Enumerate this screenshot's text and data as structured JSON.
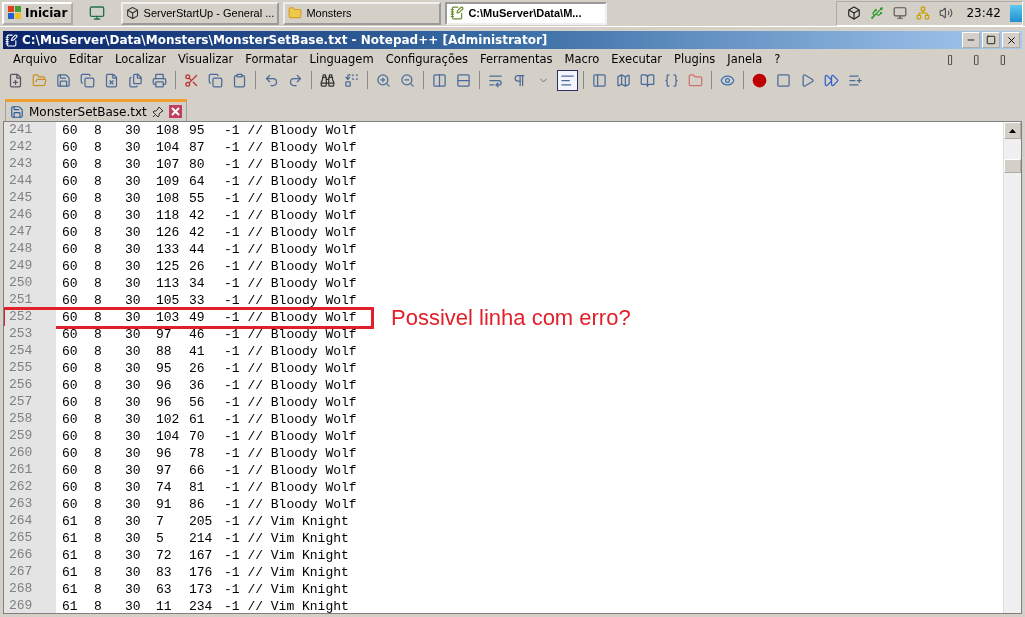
{
  "taskbar": {
    "start": "Iniciar",
    "tasks": [
      {
        "label": "ServerStartUp - General ...",
        "kind": "server",
        "selected": false
      },
      {
        "label": "Monsters",
        "kind": "folder",
        "selected": false
      },
      {
        "label": "C:\\MuServer\\Data\\M...",
        "kind": "notepad",
        "selected": true
      }
    ],
    "clock": "23:42"
  },
  "window": {
    "title": "C:\\MuServer\\Data\\Monsters\\MonsterSetBase.txt - Notepad++ [Administrator]"
  },
  "menu": [
    "Arquivo",
    "Editar",
    "Localizar",
    "Visualizar",
    "Formatar",
    "Linguagem",
    "Configurações",
    "Ferramentas",
    "Macro",
    "Executar",
    "Plugins",
    "Janela",
    "?"
  ],
  "menu_extra": [
    "▯",
    "▯",
    "▯"
  ],
  "toolbar": [
    [
      {
        "kind": "new",
        "selected": false
      },
      {
        "kind": "open",
        "selected": false
      },
      {
        "kind": "save",
        "selected": false
      },
      {
        "kind": "saveall",
        "selected": false
      },
      {
        "kind": "close",
        "selected": false
      },
      {
        "kind": "closeall",
        "selected": false
      },
      {
        "kind": "print",
        "selected": false
      }
    ],
    [
      {
        "kind": "cut",
        "selected": false
      },
      {
        "kind": "copy",
        "selected": false
      },
      {
        "kind": "paste",
        "selected": false
      }
    ],
    [
      {
        "kind": "undo",
        "selected": false
      },
      {
        "kind": "redo",
        "selected": false
      }
    ],
    [
      {
        "kind": "find",
        "selected": false
      },
      {
        "kind": "replace",
        "selected": false
      }
    ],
    [
      {
        "kind": "zoomin",
        "selected": false
      },
      {
        "kind": "zoomout",
        "selected": false
      }
    ],
    [
      {
        "kind": "syncv",
        "selected": false
      },
      {
        "kind": "synch",
        "selected": false
      }
    ],
    [
      {
        "kind": "wrap",
        "selected": false
      },
      {
        "kind": "pilcrow",
        "selected": false
      },
      {
        "kind": "dropdown",
        "selected": false
      },
      {
        "kind": "indent",
        "selected": true
      }
    ],
    [
      {
        "kind": "panel",
        "selected": false
      },
      {
        "kind": "map",
        "selected": false
      },
      {
        "kind": "docs",
        "selected": false
      },
      {
        "kind": "func",
        "selected": false
      },
      {
        "kind": "folder",
        "selected": false
      }
    ],
    [
      {
        "kind": "eye",
        "selected": false
      }
    ],
    [
      {
        "kind": "record",
        "selected": false
      },
      {
        "kind": "stop",
        "selected": false
      },
      {
        "kind": "play",
        "selected": false
      },
      {
        "kind": "playmulti",
        "selected": false
      },
      {
        "kind": "savemacro",
        "selected": false
      }
    ]
  ],
  "tabs": [
    {
      "label": "MonsterSetBase.txt",
      "selected": true
    }
  ],
  "lines": [
    {
      "number": "241",
      "cells": [
        "60",
        "8",
        "30",
        "108",
        "95",
        "-1 // Bloody Wolf"
      ],
      "marked": false
    },
    {
      "number": "242",
      "cells": [
        "60",
        "8",
        "30",
        "104",
        "87",
        "-1 // Bloody Wolf"
      ],
      "marked": false
    },
    {
      "number": "243",
      "cells": [
        "60",
        "8",
        "30",
        "107",
        "80",
        "-1 // Bloody Wolf"
      ],
      "marked": false
    },
    {
      "number": "244",
      "cells": [
        "60",
        "8",
        "30",
        "109",
        "64",
        "-1 // Bloody Wolf"
      ],
      "marked": false
    },
    {
      "number": "245",
      "cells": [
        "60",
        "8",
        "30",
        "108",
        "55",
        "-1 // Bloody Wolf"
      ],
      "marked": false
    },
    {
      "number": "246",
      "cells": [
        "60",
        "8",
        "30",
        "118",
        "42",
        "-1 // Bloody Wolf"
      ],
      "marked": false
    },
    {
      "number": "247",
      "cells": [
        "60",
        "8",
        "30",
        "126",
        "42",
        "-1 // Bloody Wolf"
      ],
      "marked": false
    },
    {
      "number": "248",
      "cells": [
        "60",
        "8",
        "30",
        "133",
        "44",
        "-1 // Bloody Wolf"
      ],
      "marked": false
    },
    {
      "number": "249",
      "cells": [
        "60",
        "8",
        "30",
        "125",
        "26",
        "-1 // Bloody Wolf"
      ],
      "marked": false
    },
    {
      "number": "250",
      "cells": [
        "60",
        "8",
        "30",
        "113",
        "34",
        "-1 // Bloody Wolf"
      ],
      "marked": false
    },
    {
      "number": "251",
      "cells": [
        "60",
        "8",
        "30",
        "105",
        "33",
        "-1 // Bloody Wolf"
      ],
      "marked": false
    },
    {
      "number": "252",
      "cells": [
        "60",
        "8",
        "30",
        "103",
        "49",
        "-1 // Bloody Wolf"
      ],
      "marked": true
    },
    {
      "number": "253",
      "cells": [
        "60",
        "8",
        "30",
        "97",
        "46",
        "-1 // Bloody Wolf"
      ],
      "marked": false
    },
    {
      "number": "254",
      "cells": [
        "60",
        "8",
        "30",
        "88",
        "41",
        "-1 // Bloody Wolf"
      ],
      "marked": false
    },
    {
      "number": "255",
      "cells": [
        "60",
        "8",
        "30",
        "95",
        "26",
        "-1 // Bloody Wolf"
      ],
      "marked": false
    },
    {
      "number": "256",
      "cells": [
        "60",
        "8",
        "30",
        "96",
        "36",
        "-1 // Bloody Wolf"
      ],
      "marked": false
    },
    {
      "number": "257",
      "cells": [
        "60",
        "8",
        "30",
        "96",
        "56",
        "-1 // Bloody Wolf"
      ],
      "marked": false
    },
    {
      "number": "258",
      "cells": [
        "60",
        "8",
        "30",
        "102",
        "61",
        "-1 // Bloody Wolf"
      ],
      "marked": false
    },
    {
      "number": "259",
      "cells": [
        "60",
        "8",
        "30",
        "104",
        "70",
        "-1 // Bloody Wolf"
      ],
      "marked": false
    },
    {
      "number": "260",
      "cells": [
        "60",
        "8",
        "30",
        "96",
        "78",
        "-1 // Bloody Wolf"
      ],
      "marked": false
    },
    {
      "number": "261",
      "cells": [
        "60",
        "8",
        "30",
        "97",
        "66",
        "-1 // Bloody Wolf"
      ],
      "marked": false
    },
    {
      "number": "262",
      "cells": [
        "60",
        "8",
        "30",
        "74",
        "81",
        "-1 // Bloody Wolf"
      ],
      "marked": false
    },
    {
      "number": "263",
      "cells": [
        "60",
        "8",
        "30",
        "91",
        "86",
        "-1 // Bloody Wolf"
      ],
      "marked": false
    },
    {
      "number": "264",
      "cells": [
        "61",
        "8",
        "30",
        "7",
        "205",
        "-1 // Vim Knight"
      ],
      "marked": false
    },
    {
      "number": "265",
      "cells": [
        "61",
        "8",
        "30",
        "5",
        "214",
        "-1 // Vim Knight"
      ],
      "marked": false
    },
    {
      "number": "266",
      "cells": [
        "61",
        "8",
        "30",
        "72",
        "167",
        "-1 // Vim Knight"
      ],
      "marked": false
    },
    {
      "number": "267",
      "cells": [
        "61",
        "8",
        "30",
        "83",
        "176",
        "-1 // Vim Knight"
      ],
      "marked": false
    },
    {
      "number": "268",
      "cells": [
        "61",
        "8",
        "30",
        "63",
        "173",
        "-1 // Vim Knight"
      ],
      "marked": false
    },
    {
      "number": "269",
      "cells": [
        "61",
        "8",
        "30",
        "11",
        "234",
        "-1 // Vim Knight"
      ],
      "marked": false
    }
  ],
  "annotation": {
    "text": "Possivel linha com erro?"
  }
}
